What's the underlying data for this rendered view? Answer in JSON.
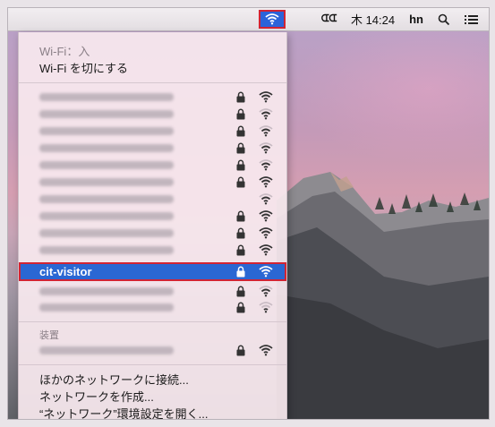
{
  "menubar": {
    "battery_text": "ᗭᗭ",
    "clock": "木 14:24",
    "user": "hn",
    "search_icon": "search-icon",
    "list_icon": "list-icon"
  },
  "wifi_menu": {
    "status_label": "Wi-Fi：入",
    "toggle_label": "Wi-Fi を切にする",
    "networks": [
      {
        "name": "",
        "locked": true,
        "signal": 3
      },
      {
        "name": "",
        "locked": true,
        "signal": 2
      },
      {
        "name": "",
        "locked": true,
        "signal": 2
      },
      {
        "name": "",
        "locked": true,
        "signal": 2
      },
      {
        "name": "",
        "locked": true,
        "signal": 2
      },
      {
        "name": "",
        "locked": true,
        "signal": 3
      },
      {
        "name": "",
        "locked": false,
        "signal": 2
      },
      {
        "name": "",
        "locked": true,
        "signal": 3
      },
      {
        "name": "",
        "locked": true,
        "signal": 3
      },
      {
        "name": "",
        "locked": true,
        "signal": 3
      }
    ],
    "selected_network": {
      "name": "cit-visitor",
      "locked": true,
      "signal": 3
    },
    "after_networks": [
      {
        "name": "",
        "locked": true,
        "signal": 2
      },
      {
        "name": "",
        "locked": true,
        "signal": 1
      }
    ],
    "devices_header": "装置",
    "devices": [
      {
        "name": "",
        "locked": true,
        "signal": 3
      }
    ],
    "actions": [
      "ほかのネットワークに接続...",
      "ネットワークを作成...",
      "“ネットワーク”環境設定を開く..."
    ]
  },
  "colors": {
    "selection": "#2a67d3",
    "highlight_border": "#d12434"
  }
}
